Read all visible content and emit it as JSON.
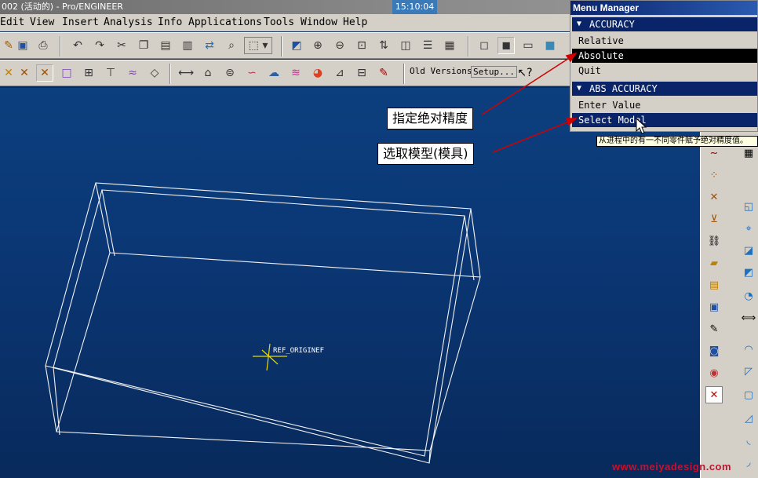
{
  "window": {
    "title": "002 (活动的) - Pro/ENGINEER",
    "clock": "15:10:04"
  },
  "menubar": {
    "items": [
      "Edit",
      "View",
      "Insert",
      "Analysis",
      "Info",
      "Applications",
      "Tools",
      "Window",
      "Help"
    ]
  },
  "toolbar2": {
    "old_versions": "Old Versions",
    "setup": "Setup..."
  },
  "menu_manager": {
    "title": "Menu Manager",
    "accuracy_header": "ACCURACY",
    "relative": "Relative",
    "absolute": "Absolute",
    "quit": "Quit",
    "abs_header": "ABS ACCURACY",
    "enter_value": "Enter Value",
    "select_model": "Select Model"
  },
  "tooltip": "从进程中的有一不同零件赋予绝对精度值。",
  "callouts": {
    "absolute_note": "指定绝对精度",
    "select_note": "选取模型(模具)"
  },
  "model": {
    "datum_label": "REF_ORIGINEF"
  },
  "watermark": "www.meiyadesign.com",
  "colors": {
    "viewport_top": "#0c3f7e",
    "viewport_bottom": "#082a5c",
    "highlight": "#0a246a",
    "watermark": "#c8102e",
    "arrow": "#d00000"
  }
}
